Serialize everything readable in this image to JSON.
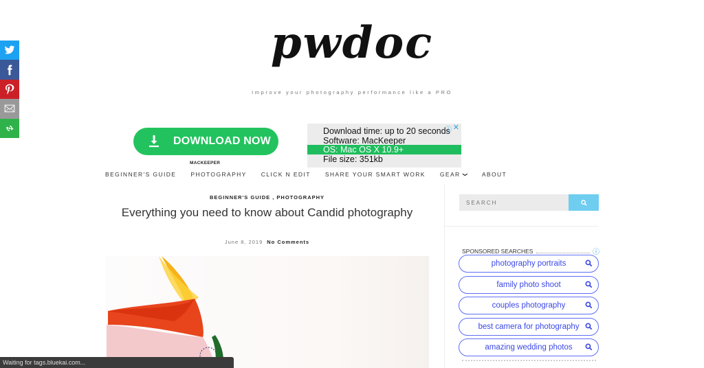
{
  "site": {
    "logo": "pwdoc",
    "tagline": "Improve your photography performance like a PRO"
  },
  "share": {
    "items": [
      {
        "name": "twitter",
        "icon": "twitter-icon",
        "color": "#1da1f2"
      },
      {
        "name": "facebook",
        "icon": "facebook-icon",
        "color": "#3b5998"
      },
      {
        "name": "pinterest",
        "icon": "pinterest-icon",
        "color": "#cb2027"
      },
      {
        "name": "email",
        "icon": "email-icon",
        "color": "#999999"
      },
      {
        "name": "more",
        "icon": "more-share-icon",
        "color": "#30b24a"
      }
    ]
  },
  "ad_left": {
    "button_label": "DOWNLOAD NOW",
    "brand": "MACKEEPER",
    "color": "#22c35e"
  },
  "ad_right": {
    "lines": [
      "Download time: up to 20 seconds",
      "Software: MacKeeper",
      "OS: Mac OS X 10.9+",
      "File size: 351kb"
    ],
    "highlight_color": "#1fbd5d",
    "info_icon": "ⓘ",
    "close_icon": "✕"
  },
  "nav": {
    "items": [
      "BEGINNER'S GUIDE",
      "PHOTOGRAPHY",
      "CLICK N EDIT",
      "SHARE YOUR SMART WORK",
      "GEAR",
      "ABOUT"
    ],
    "gear_chevron": "❯"
  },
  "post": {
    "categories": "BEGINNER'S GUIDE",
    "categories_sep": " , ",
    "categories2": "PHOTOGRAPHY",
    "title": "Everything you need to know about Candid photography",
    "date": "June 8, 2019",
    "comments": "No Comments"
  },
  "sidebar": {
    "search_placeholder": "SEARCH",
    "search_button_color": "#6fcdf0",
    "sponsored_heading": "SPONSORED SEARCHES",
    "sponsored_items": [
      "photography portraits",
      "family photo shoot",
      "couples photography",
      "best camera for photography",
      "amazing wedding photos"
    ]
  },
  "status_bar": {
    "text": "Waiting for tags.bluekai.com..."
  }
}
